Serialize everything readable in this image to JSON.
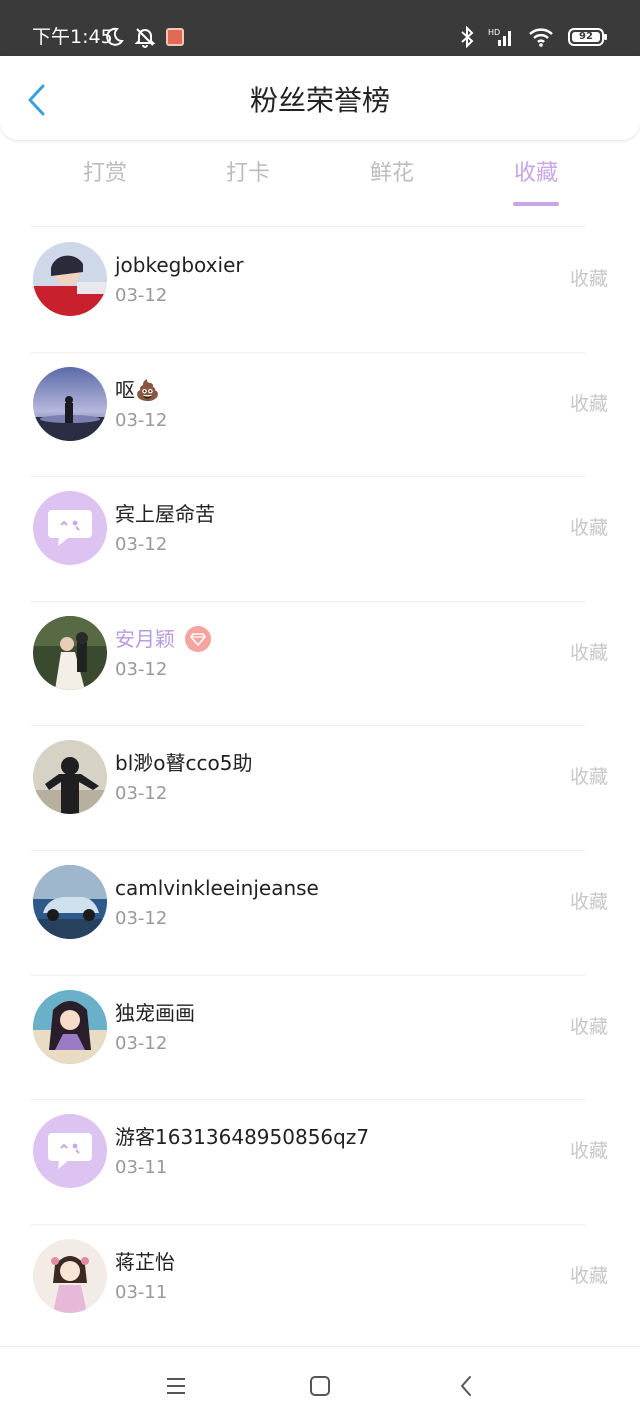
{
  "status_bar": {
    "time": "下午1:45",
    "battery_level": "92",
    "icons": [
      "moon-icon",
      "bell-off-icon",
      "app-notification-icon",
      "bluetooth-icon",
      "signal-hd-icon",
      "wifi-icon",
      "battery-icon"
    ]
  },
  "header": {
    "title": "粉丝荣誉榜",
    "back_icon": "chevron-left-icon"
  },
  "tabs": [
    {
      "label": "打赏",
      "active": false
    },
    {
      "label": "打卡",
      "active": false
    },
    {
      "label": "鲜花",
      "active": false
    },
    {
      "label": "收藏",
      "active": true
    }
  ],
  "colors": {
    "accent": "#c9a6e8",
    "back_arrow": "#3a9ee0",
    "vip_name": "#b99be0",
    "muted": "#999999",
    "action": "#c8c8c8",
    "default_avatar_bg": "#dcc3f1"
  },
  "fans": [
    {
      "name": "jobkegboxier",
      "date": "03-12",
      "action": "收藏",
      "avatar": "photo-girl-red-jacket",
      "vip": false
    },
    {
      "name": "呕💩",
      "date": "03-12",
      "action": "收藏",
      "avatar": "photo-dusk-skyline",
      "vip": false
    },
    {
      "name": "宾上屋命苦",
      "date": "03-12",
      "action": "收藏",
      "avatar": "default-chat-bubble",
      "vip": false
    },
    {
      "name": "安月颖",
      "date": "03-12",
      "action": "收藏",
      "avatar": "photo-wedding-couple",
      "vip": true,
      "badge": "diamond-badge-icon"
    },
    {
      "name": "bl渺o瞽cco5助",
      "date": "03-12",
      "action": "收藏",
      "avatar": "photo-man-hoodie",
      "vip": false
    },
    {
      "name": "camlvinkleeinjeanse",
      "date": "03-12",
      "action": "收藏",
      "avatar": "photo-blue-car",
      "vip": false
    },
    {
      "name": "独宠画画",
      "date": "03-12",
      "action": "收藏",
      "avatar": "photo-anime-girl",
      "vip": false
    },
    {
      "name": "游客16313648950856qz7",
      "date": "03-11",
      "action": "收藏",
      "avatar": "default-chat-bubble",
      "vip": false
    },
    {
      "name": "蒋芷怡",
      "date": "03-11",
      "action": "收藏",
      "avatar": "photo-illustrated-girl",
      "vip": false
    }
  ],
  "nav_bar": {
    "icons": [
      "menu-icon",
      "home-square-icon",
      "back-triangle-icon"
    ]
  }
}
